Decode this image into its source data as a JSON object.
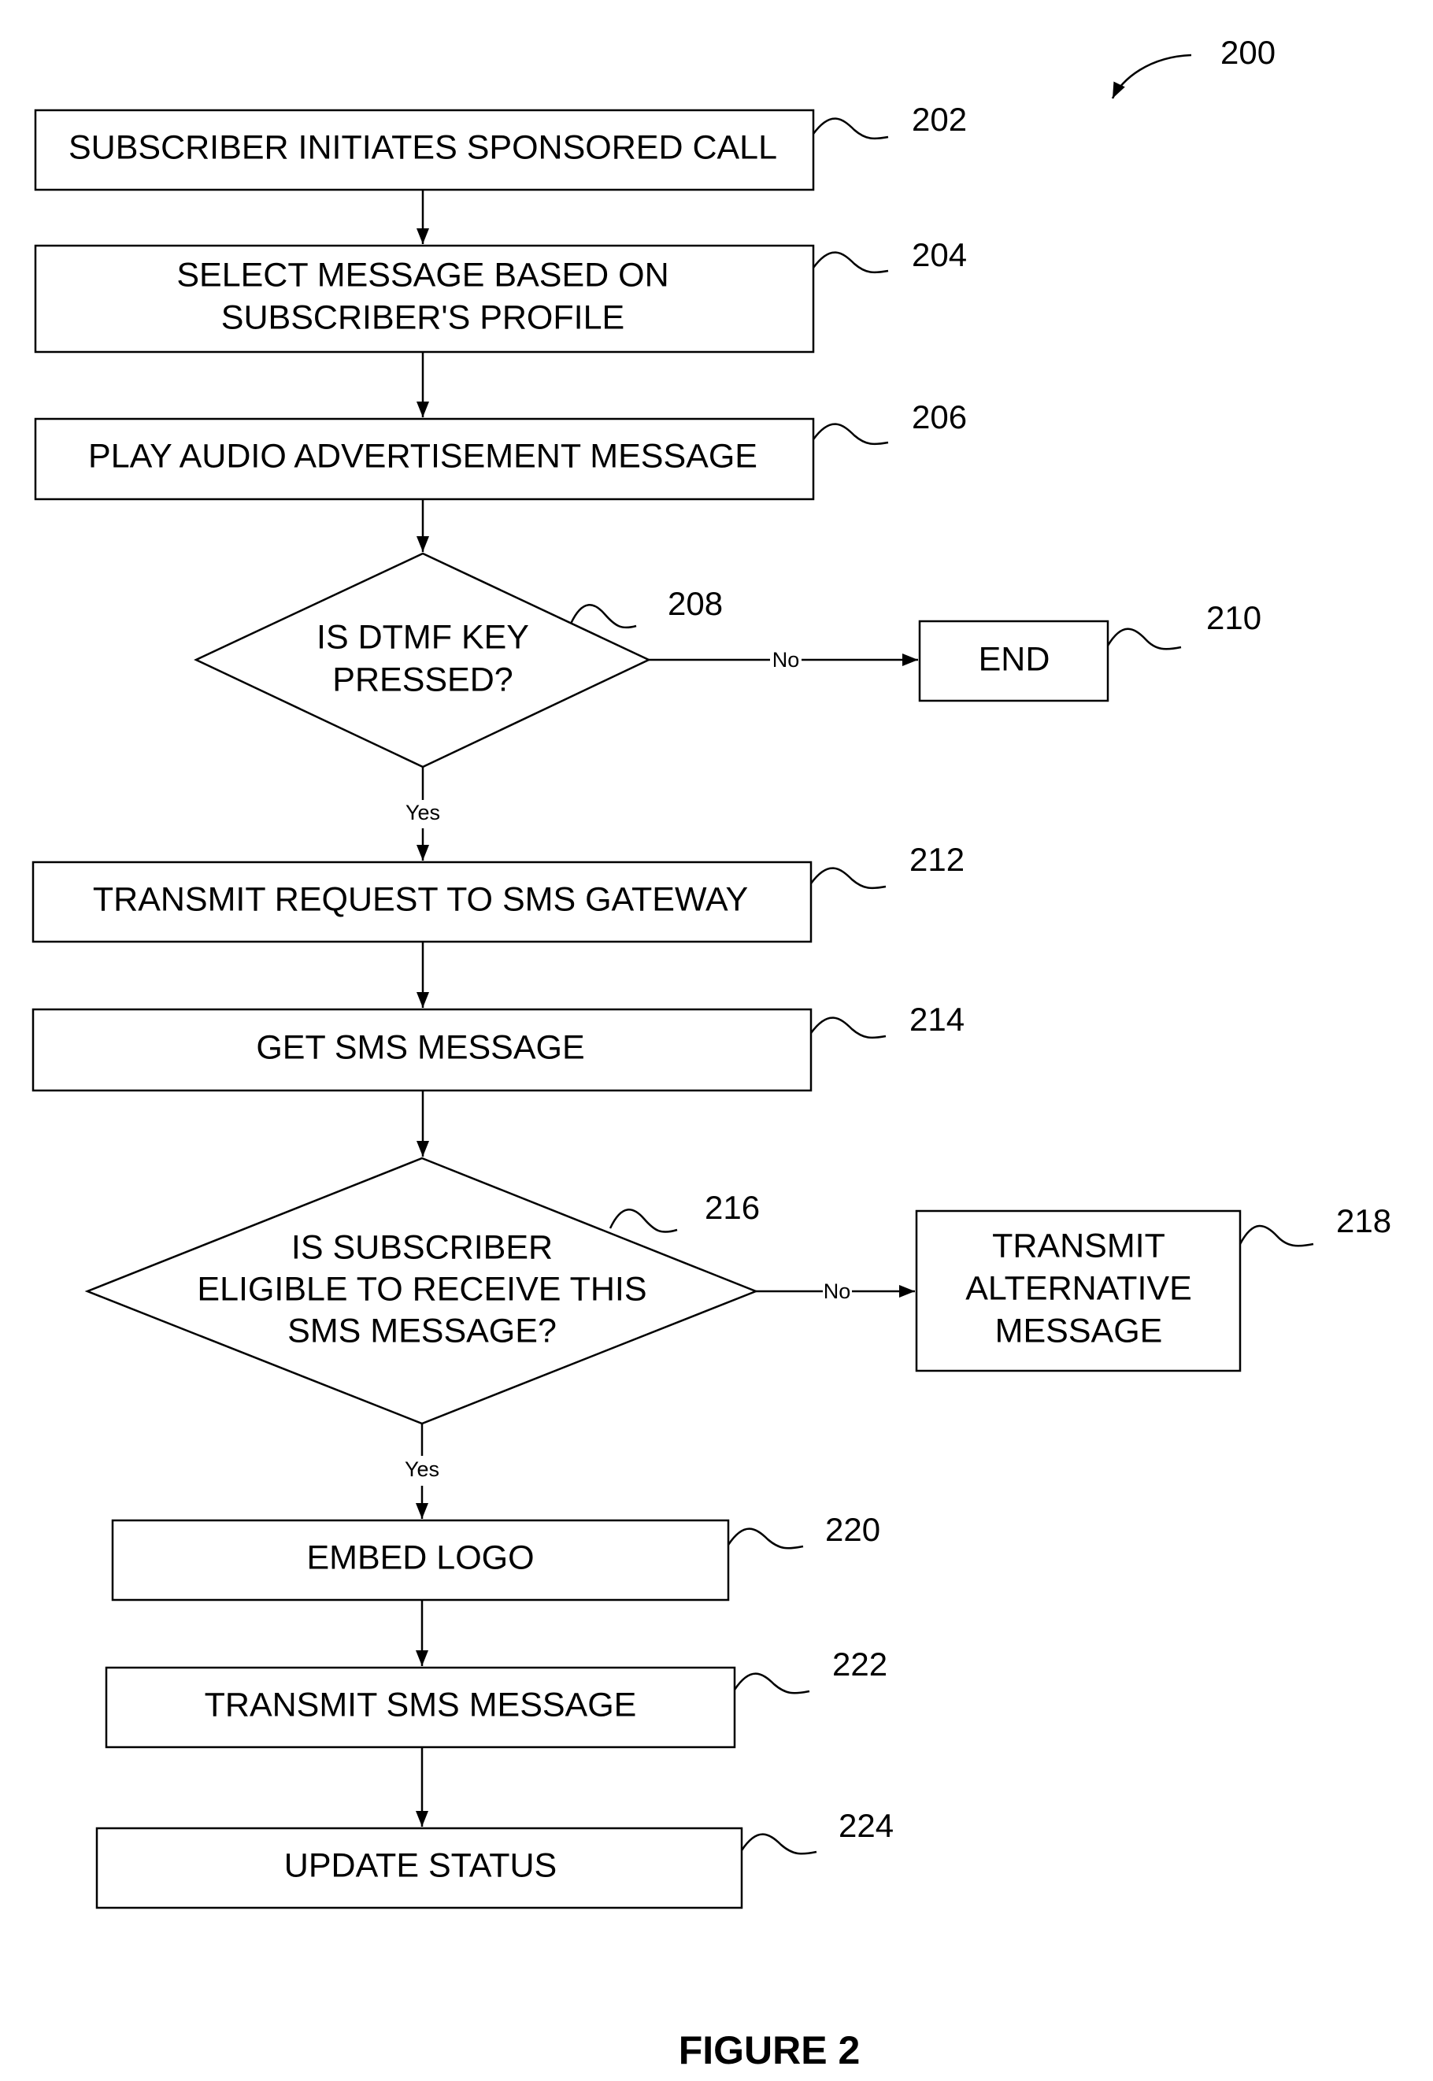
{
  "figure": {
    "ref_number": "200",
    "caption": "FIGURE 2"
  },
  "steps": {
    "s202": {
      "ref": "202",
      "lines": [
        "SUBSCRIBER INITIATES SPONSORED CALL"
      ]
    },
    "s204": {
      "ref": "204",
      "lines": [
        "SELECT MESSAGE BASED ON",
        "SUBSCRIBER'S PROFILE"
      ]
    },
    "s206": {
      "ref": "206",
      "lines": [
        "PLAY AUDIO ADVERTISEMENT MESSAGE"
      ]
    },
    "s208": {
      "ref": "208",
      "lines": [
        "IS DTMF KEY",
        "PRESSED?"
      ],
      "yes_label": "Yes",
      "no_label": "No"
    },
    "s210": {
      "ref": "210",
      "lines": [
        "END"
      ]
    },
    "s212": {
      "ref": "212",
      "lines": [
        "TRANSMIT REQUEST TO SMS GATEWAY"
      ]
    },
    "s214": {
      "ref": "214",
      "lines": [
        "GET SMS MESSAGE"
      ]
    },
    "s216": {
      "ref": "216",
      "lines": [
        "IS SUBSCRIBER",
        "ELIGIBLE TO RECEIVE THIS",
        "SMS MESSAGE?"
      ],
      "yes_label": "Yes",
      "no_label": "No"
    },
    "s218": {
      "ref": "218",
      "lines": [
        "TRANSMIT",
        "ALTERNATIVE",
        "MESSAGE"
      ]
    },
    "s220": {
      "ref": "220",
      "lines": [
        "EMBED LOGO"
      ]
    },
    "s222": {
      "ref": "222",
      "lines": [
        "TRANSMIT SMS MESSAGE"
      ]
    },
    "s224": {
      "ref": "224",
      "lines": [
        "UPDATE STATUS"
      ]
    }
  }
}
